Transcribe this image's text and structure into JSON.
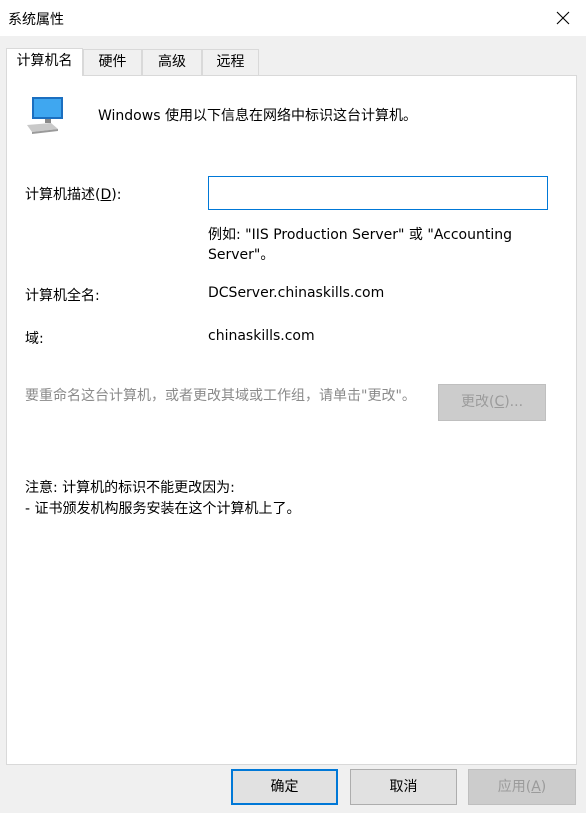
{
  "window": {
    "title": "系统属性"
  },
  "tabs": [
    {
      "label": "计算机名"
    },
    {
      "label": "硬件"
    },
    {
      "label": "高级"
    },
    {
      "label": "远程"
    }
  ],
  "panel": {
    "intro_text": "Windows 使用以下信息在网络中标识这台计算机。",
    "description_label_prefix": "计算机描述(",
    "description_label_key": "D",
    "description_label_suffix": "):",
    "description_value": "",
    "example_text": "例如: \"IIS Production Server\" 或 \"Accounting Server\"。",
    "fullname_label": "计算机全名:",
    "fullname_value": "DCServer.chinaskills.com",
    "domain_label": "域:",
    "domain_value": "chinaskills.com",
    "rename_text": "要重命名这台计算机，或者更改其域或工作组，请单击\"更改\"。",
    "change_button_prefix": "更改(",
    "change_button_key": "C",
    "change_button_suffix": ")...",
    "note_title": "注意: 计算机的标识不能更改因为:",
    "note_item": "- 证书颁发机构服务安装在这个计算机上了。"
  },
  "footer": {
    "ok_label": "确定",
    "cancel_label": "取消",
    "apply_prefix": "应用(",
    "apply_key": "A",
    "apply_suffix": ")"
  },
  "icons": {
    "close": "close-icon",
    "computer": "computer-icon"
  }
}
